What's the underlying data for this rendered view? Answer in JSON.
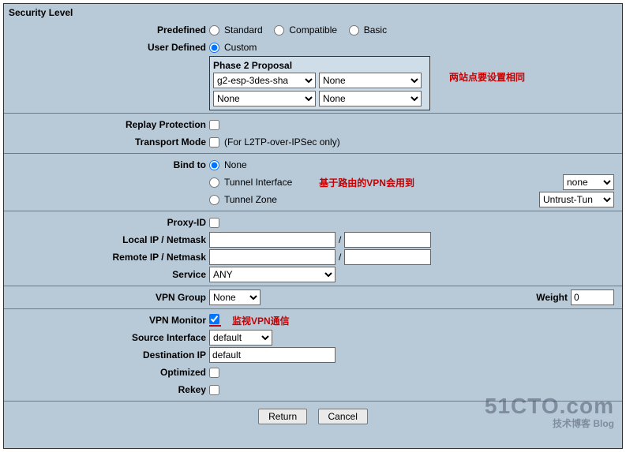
{
  "heading": "Security Level",
  "security": {
    "predefined_label": "Predefined",
    "standard": "Standard",
    "compatible": "Compatible",
    "basic": "Basic",
    "user_defined_label": "User Defined",
    "custom": "Custom"
  },
  "proposal": {
    "title": "Phase 2 Proposal",
    "sel1": "g2-esp-3des-sha",
    "sel2": "None",
    "sel3": "None",
    "sel4": "None",
    "note": "两站点要设置相同"
  },
  "replay": {
    "label": "Replay Protection"
  },
  "transport": {
    "label": "Transport Mode",
    "hint": "(For L2TP-over-IPSec only)"
  },
  "bind": {
    "label": "Bind to",
    "none": "None",
    "tunnel_if": "Tunnel Interface",
    "tunnel_zone": "Tunnel Zone",
    "note": "基于路由的VPN会用到",
    "if_sel": "none",
    "zone_sel": "Untrust-Tun"
  },
  "proxy": {
    "label": "Proxy-ID",
    "local_label": "Local IP / Netmask",
    "remote_label": "Remote IP / Netmask",
    "slash": "/",
    "service_label": "Service",
    "service_val": "ANY"
  },
  "vpngroup": {
    "label": "VPN Group",
    "val": "None",
    "weight_label": "Weight",
    "weight_val": "0"
  },
  "monitor": {
    "label": "VPN Monitor",
    "note": "监视VPN通信",
    "src_if_label": "Source Interface",
    "src_if_val": "default",
    "dst_ip_label": "Destination IP",
    "dst_ip_val": "default",
    "optimized_label": "Optimized",
    "rekey_label": "Rekey"
  },
  "buttons": {
    "return": "Return",
    "cancel": "Cancel"
  },
  "watermark": {
    "big": "51CTO.com",
    "small": "技术博客   Blog"
  }
}
